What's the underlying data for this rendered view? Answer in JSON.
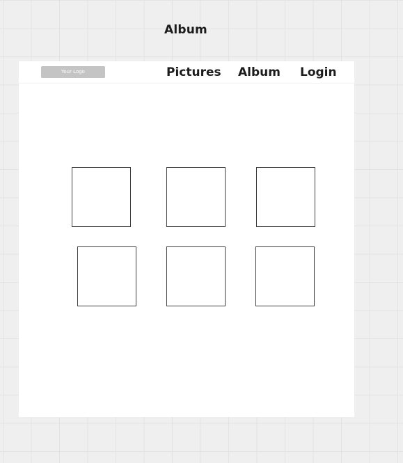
{
  "canvas": {
    "title": "Album"
  },
  "header": {
    "logo_text": "Your Logo",
    "nav": [
      {
        "label": "Pictures"
      },
      {
        "label": "Album"
      },
      {
        "label": "Login"
      }
    ]
  },
  "gallery": {
    "rows": 2,
    "columns": 3,
    "tile_count": 6
  }
}
